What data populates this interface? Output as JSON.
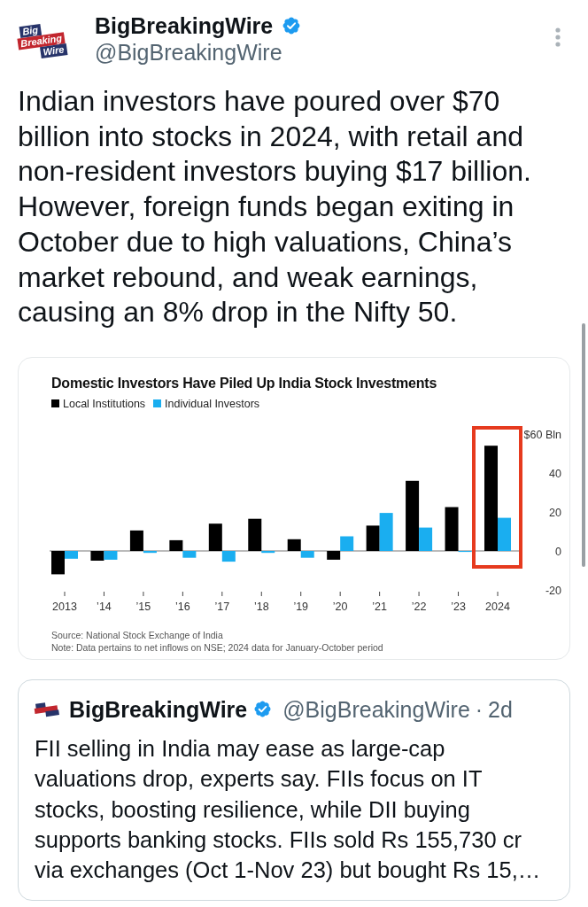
{
  "post": {
    "author": {
      "logo_lines": [
        "Big",
        "Breaking",
        "Wire"
      ],
      "name": "BigBreakingWire",
      "verified": true,
      "handle": "@BigBreakingWire"
    },
    "text": "Indian investors have poured over $70 billion into stocks in 2024, with retail and non-resident investors buying $17 billion. However, foreign funds began exiting in October due to high valuations, China’s market rebound, and weak earnings, causing an 8% drop in the Nifty 50.",
    "chart": {
      "chart_data": {
        "type": "bar",
        "title": "Domestic Investors Have Piled Up India Stock Investments",
        "categories": [
          "2013",
          "’14",
          "’15",
          "’16",
          "’17",
          "’18",
          "’19",
          "’20",
          "’21",
          "’22",
          "’23",
          "2024"
        ],
        "series": [
          {
            "name": "Local Institutions",
            "color": "#000000",
            "values": [
              -12,
              -5,
              10.5,
              5.5,
              14,
              16.5,
              6,
              -4.5,
              13,
              36,
              22.5,
              54
            ]
          },
          {
            "name": "Individual Investors",
            "color": "#1aaef0",
            "values": [
              -4,
              -4.5,
              -1,
              -3.5,
              -5.5,
              -1,
              -3.5,
              7.5,
              19.5,
              12,
              -0.5,
              17
            ]
          }
        ],
        "ylim": [
          -20,
          60
        ],
        "yticks": [
          {
            "value": -20,
            "label": "-20"
          },
          0,
          20,
          40,
          {
            "value": 60,
            "label": "$60 Bln"
          }
        ]
      },
      "highlighted": [
        false,
        false,
        false,
        false,
        false,
        false,
        false,
        false,
        false,
        false,
        false,
        true
      ],
      "source": "Source: National Stock Exchange of India",
      "note": "Note: Data pertains to net inflows on NSE; 2024 data for January-October period"
    }
  },
  "quoted_post": {
    "author": {
      "name": "BigBreakingWire",
      "verified": true,
      "handle": "@BigBreakingWire"
    },
    "separator": "·",
    "time": "2d",
    "text": "FII selling in India may ease as large-cap valuations drop, experts say. FIIs focus on IT stocks, boosting resilience, while DII buying supports banking stocks. FIIs sold Rs 155,730 cr via exchanges (Oct 1-Nov 23) but bought Rs 15,…"
  }
}
